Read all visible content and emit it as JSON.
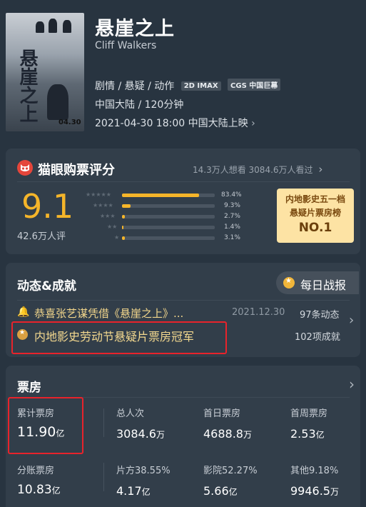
{
  "movie": {
    "poster_title": "悬崖之上",
    "poster_date": "04.30",
    "title": "悬崖之上",
    "english_title": "Cliff Walkers",
    "genres": "剧情 / 悬疑 / 动作",
    "badges": [
      "2D IMAX",
      "CGS 中国巨幕"
    ],
    "region_duration": "中国大陆 / 120分钟",
    "release": "2021-04-30 18:00 中国大陆上映"
  },
  "rating": {
    "header": "猫眼购票评分",
    "want_watched": "14.3万人想看  3084.6万人看过",
    "score": "9.1",
    "raters": "42.6万人评",
    "distribution": [
      {
        "stars": 5,
        "label": "83.4%",
        "fraction": 0.834
      },
      {
        "stars": 4,
        "label": "9.3%",
        "fraction": 0.093
      },
      {
        "stars": 3,
        "label": "2.7%",
        "fraction": 0.027
      },
      {
        "stars": 2,
        "label": "1.4%",
        "fraction": 0.014
      },
      {
        "stars": 1,
        "label": "3.1%",
        "fraction": 0.031
      }
    ],
    "rank_line1": "内地影史五一档",
    "rank_line2": "悬疑片票房榜",
    "rank_value": "NO.1"
  },
  "dynamics": {
    "header": "动态&成就",
    "daily_button": "每日战报",
    "news_text": "恭喜张艺谋凭借《悬崖之上》...",
    "news_date": "2021.12.30",
    "news_count": "97条动态",
    "achievement_text": "内地影史劳动节悬疑片票房冠军",
    "achievement_count": "102项成就"
  },
  "boxoffice": {
    "header": "票房",
    "row1": [
      {
        "label": "累计票房",
        "value": "11.90",
        "unit": "亿"
      },
      {
        "label": "总人次",
        "value": "3084.6",
        "unit": "万"
      },
      {
        "label": "首日票房",
        "value": "4688.8",
        "unit": "万"
      },
      {
        "label": "首周票房",
        "value": "2.53",
        "unit": "亿"
      }
    ],
    "row2": [
      {
        "label": "分账票房",
        "value": "10.83",
        "unit": "亿"
      },
      {
        "label": "片方38.55%",
        "value": "4.17",
        "unit": "亿"
      },
      {
        "label": "影院52.27%",
        "value": "5.66",
        "unit": "亿"
      },
      {
        "label": "其他9.18%",
        "value": "9946.5",
        "unit": "万"
      }
    ]
  }
}
